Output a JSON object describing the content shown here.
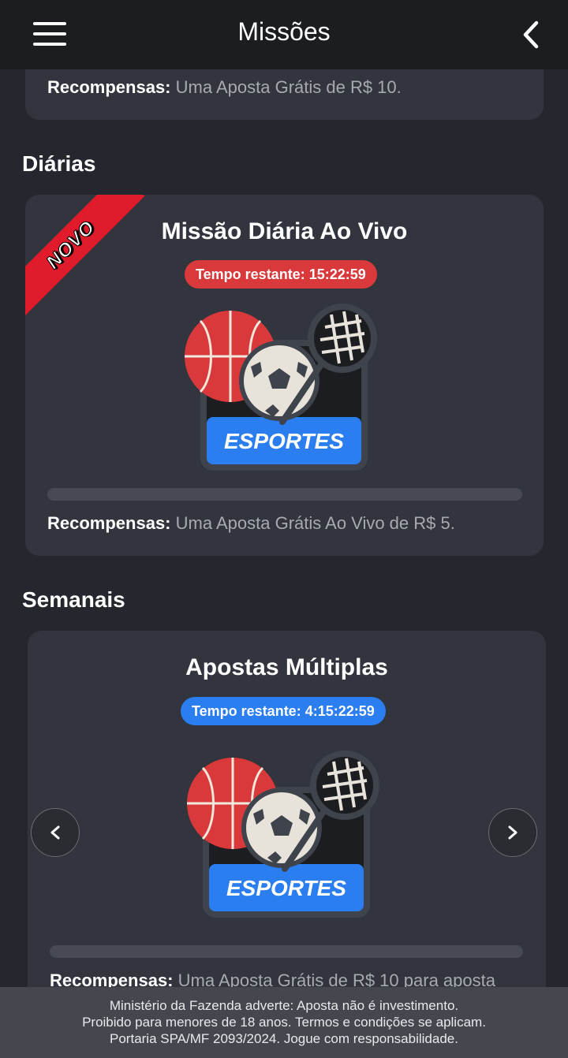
{
  "header": {
    "title": "Missões"
  },
  "top_card": {
    "reward_label": "Recompensas:",
    "reward_text": " Uma Aposta Grátis de R$ 10."
  },
  "sections": {
    "daily": "Diárias",
    "weekly": "Semanais"
  },
  "daily_mission": {
    "badge": "NOVO",
    "title": "Missão Diária Ao Vivo",
    "timer": "Tempo restante: 15:22:59",
    "image_label": "ESPORTES",
    "progress": 0,
    "reward_label": "Recompensas:",
    "reward_text": " Uma Aposta Grátis Ao Vivo de R$ 5."
  },
  "weekly_mission": {
    "title": "Apostas Múltiplas",
    "timer": "Tempo restante: 4:15:22:59",
    "image_label": "ESPORTES",
    "progress": 0,
    "reward_label": "Recompensas:",
    "reward_text": " Uma Aposta Grátis de R$ 10 para aposta"
  },
  "footer": {
    "line1": "Ministério da Fazenda adverte: Aposta não é investimento.",
    "line2": "Proibido para menores de 18 anos. Termos e condições se aplicam.",
    "line3": "Portaria SPA/MF 2093/2024. Jogue com responsabilidade."
  },
  "colors": {
    "background": "#24272d",
    "card": "#32353d",
    "timer_red": "#d9393a",
    "timer_blue": "#2a7ef0",
    "ribbon": "#e01b2b",
    "esportes_blue": "#2a7ef0"
  },
  "icons": [
    "menu-icon",
    "back-chevron-icon",
    "chevron-left-icon",
    "chevron-right-icon",
    "sports-icon"
  ]
}
